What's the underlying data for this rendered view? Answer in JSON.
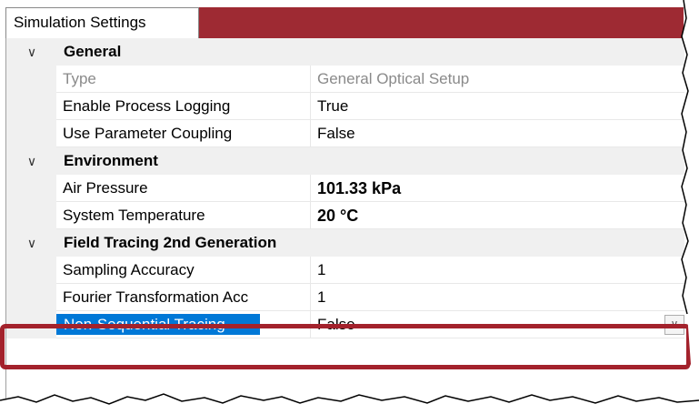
{
  "tab": {
    "label": "Simulation Settings"
  },
  "categories": [
    {
      "label": "General",
      "expanded": true,
      "properties": [
        {
          "name": "Type",
          "value": "General Optical Setup",
          "readonly": true
        },
        {
          "name": "Enable Process Logging",
          "value": "True"
        },
        {
          "name": "Use Parameter Coupling",
          "value": "False"
        }
      ]
    },
    {
      "label": "Environment",
      "expanded": true,
      "properties": [
        {
          "name": "Air Pressure",
          "value": "101.33 kPa",
          "bold": true
        },
        {
          "name": "System Temperature",
          "value": "20 °C",
          "bold": true
        }
      ]
    },
    {
      "label": "Field Tracing 2nd Generation",
      "expanded": true,
      "properties": [
        {
          "name": "Sampling Accuracy",
          "value": "1"
        },
        {
          "name": "Fourier Transformation Acc",
          "value": "1"
        },
        {
          "name": "Non-Sequential Tracing",
          "value": "False",
          "selected": true
        }
      ]
    }
  ],
  "icons": {
    "expand": "chevron-down-icon",
    "dropdown": "dropdown-arrow-icon"
  },
  "colors": {
    "accent": "#9e2a33",
    "highlight": "#a3222c",
    "selection": "#0078d7"
  }
}
